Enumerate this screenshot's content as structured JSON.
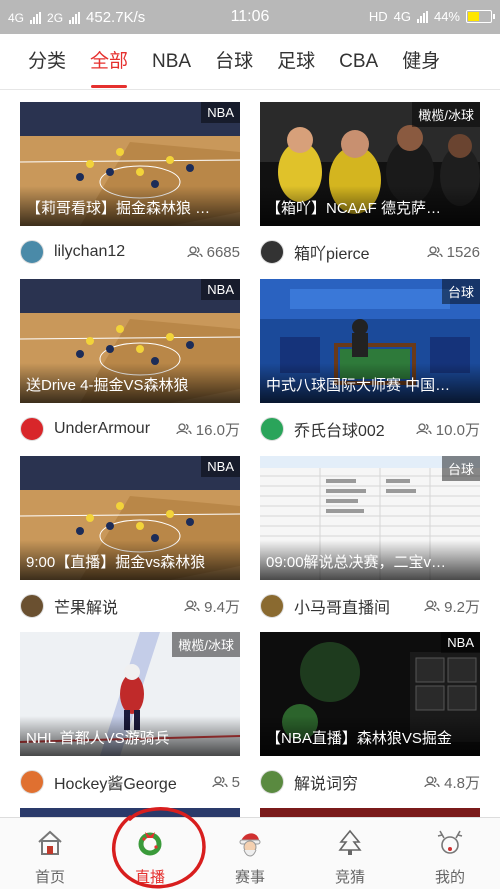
{
  "status_bar": {
    "network1": "4G",
    "network2": "2G",
    "speed": "452.7K/s",
    "time": "11:06",
    "hd": "HD",
    "network3": "4G",
    "battery": "44%"
  },
  "tabs": [
    {
      "label": "分类",
      "active": false
    },
    {
      "label": "全部",
      "active": true
    },
    {
      "label": "NBA",
      "active": false
    },
    {
      "label": "台球",
      "active": false
    },
    {
      "label": "足球",
      "active": false
    },
    {
      "label": "CBA",
      "active": false
    },
    {
      "label": "健身",
      "active": false
    }
  ],
  "cards": [
    {
      "badge": "NBA",
      "title": "【莉哥看球】掘金森林狼 …",
      "author": "lilychan12",
      "viewers": "6685",
      "scene": "court",
      "avatar_color": "#4a8aa8"
    },
    {
      "badge": "橄榄/冰球",
      "title": "【箱吖】NCAAF 德克萨…",
      "author": "箱吖pierce",
      "viewers": "1526",
      "scene": "crowd",
      "avatar_color": "#333333"
    },
    {
      "badge": "NBA",
      "title": "送Drive 4-掘金VS森林狼",
      "author": "UnderArmour",
      "viewers": "16.0万",
      "scene": "court",
      "avatar_color": "#d8262a"
    },
    {
      "badge": "台球",
      "title": "中式八球国际大师赛 中国…",
      "author": "乔氏台球002",
      "viewers": "10.0万",
      "scene": "snooker",
      "avatar_color": "#2aa45a"
    },
    {
      "badge": "NBA",
      "title": "9:00【直播】掘金vs森林狼",
      "author": "芒果解说",
      "viewers": "9.4万",
      "scene": "court",
      "avatar_color": "#6a5030"
    },
    {
      "badge": "台球",
      "title": "09:00解说总决赛，二宝v…",
      "author": "小马哥直播间",
      "viewers": "9.2万",
      "scene": "sheet",
      "avatar_color": "#8a6a30"
    },
    {
      "badge": "橄榄/冰球",
      "title": "NHL 首都人VS游骑兵",
      "author": "Hockey酱George",
      "viewers": "5",
      "scene": "ice",
      "avatar_color": "#e07030"
    },
    {
      "badge": "NBA",
      "title": "【NBA直播】森林狼VS掘金",
      "author": "解说词穷",
      "viewers": "4.8万",
      "scene": "arena",
      "avatar_color": "#5a8a40"
    }
  ],
  "bottom_nav": [
    {
      "label": "首页",
      "icon": "home-icon",
      "active": false
    },
    {
      "label": "直播",
      "icon": "wreath-icon",
      "active": true
    },
    {
      "label": "赛事",
      "icon": "santa-icon",
      "active": false
    },
    {
      "label": "竞猜",
      "icon": "tree-icon",
      "active": false
    },
    {
      "label": "我的",
      "icon": "reindeer-icon",
      "active": false
    }
  ],
  "colors": {
    "accent": "#e5302e",
    "text": "#333333"
  }
}
